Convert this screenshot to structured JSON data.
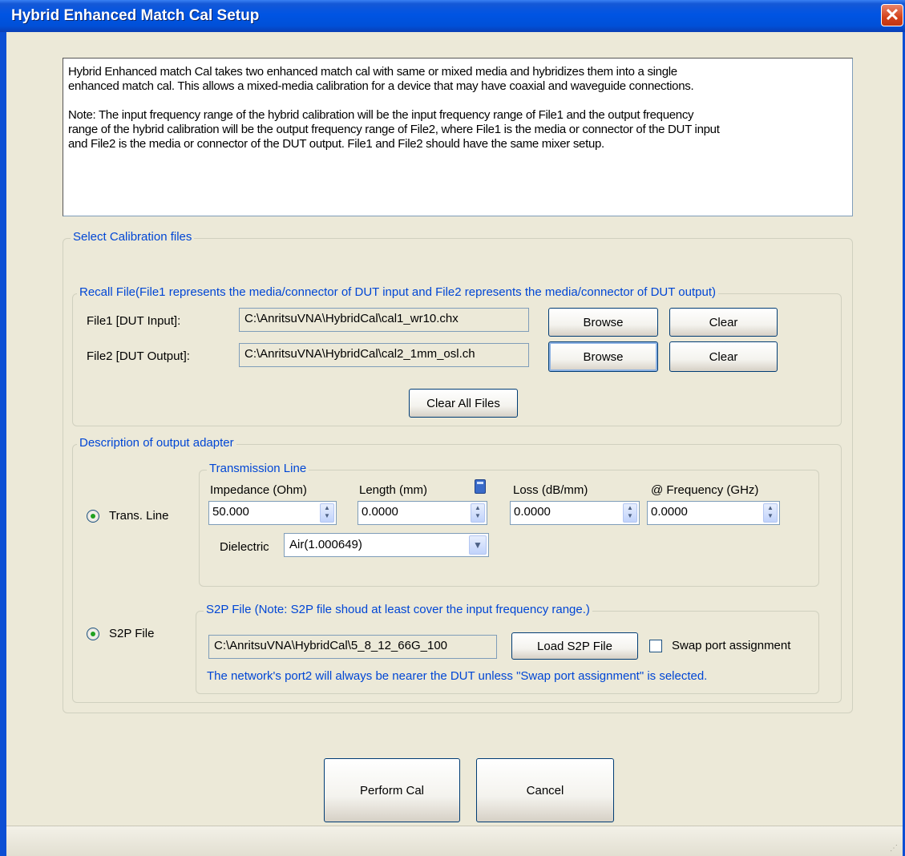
{
  "window": {
    "title": "Hybrid Enhanced Match Cal Setup",
    "close_label": "✕"
  },
  "description": {
    "paragraph1": "Hybrid Enhanced match Cal takes two enhanced match cal with same or mixed media and hybridizes them into a single\nenhanced match cal.  This allows a mixed-media calibration for a device that may have coaxial and waveguide connections.",
    "paragraph2": "Note: The input frequency range of the hybrid calibration will be the input frequency range of File1 and the output frequency\nrange of the hybrid calibration will be the output frequency range of File2, where File1 is the media or connector of the DUT input\nand File2 is the media or connector of the DUT output. File1 and File2 should have the same mixer setup."
  },
  "calibration_files": {
    "legend": "Select Calibration files",
    "recall_legend": "Recall File(File1 represents the media/connector of DUT input and File2 represents the media/connector of DUT output)",
    "file1": {
      "label": "File1 [DUT Input]:",
      "path": "C:\\AnritsuVNA\\HybridCal\\cal1_wr10.chx",
      "browse_label": "Browse",
      "clear_label": "Clear"
    },
    "file2": {
      "label": "File2 [DUT Output]:",
      "path": "C:\\AnritsuVNA\\HybridCal\\cal2_1mm_osl.ch",
      "browse_label": "Browse",
      "clear_label": "Clear"
    },
    "clear_all_label": "Clear All Files"
  },
  "output_adapter": {
    "legend": "Description of output adapter",
    "trans_line": {
      "radio_label": "Trans. Line",
      "group_legend": "Transmission Line",
      "impedance_label": "Impedance (Ohm)",
      "impedance_value": "50.000",
      "length_label": "Length (mm)",
      "length_value": "0.0000",
      "loss_label": "Loss (dB/mm)",
      "loss_value": "0.0000",
      "frequency_label": "@ Frequency (GHz)",
      "frequency_value": "0.0000",
      "dielectric_label": "Dielectric",
      "dielectric_value": "Air(1.000649)"
    },
    "s2p": {
      "radio_label": "S2P File",
      "group_legend": "S2P File (Note: S2P file shoud at least cover the input frequency range.)",
      "path": "C:\\AnritsuVNA\\HybridCal\\5_8_12_66G_100",
      "load_label": "Load S2P File",
      "swap_label": "Swap port assignment",
      "note": "The network's port2 will always be nearer the DUT unless \"Swap port assignment\" is selected."
    }
  },
  "actions": {
    "perform_label": "Perform Cal",
    "cancel_label": "Cancel"
  },
  "colors": {
    "titlebar": "#0054e3",
    "legend_text": "#0046d5",
    "dialog_bg": "#ece9d8"
  }
}
